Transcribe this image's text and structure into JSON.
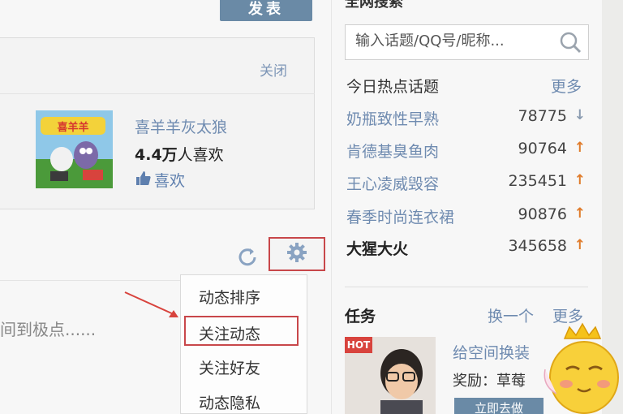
{
  "publish": {
    "label": "发表"
  },
  "recommend": {
    "close": "关闭",
    "game_title": "喜羊羊灰太狼",
    "likes_number": "4.4万",
    "likes_suffix": "人喜欢",
    "like_label": "喜欢"
  },
  "feed": {
    "text": "间到极点......"
  },
  "feed_menu": {
    "items": [
      "动态排序",
      "关注动态",
      "关注好友",
      "动态隐私"
    ],
    "highlighted_index": 1
  },
  "search": {
    "title": "全网搜索",
    "placeholder": "输入话题/QQ号/昵称..."
  },
  "hot_topics": {
    "title": "今日热点话题",
    "more": "更多",
    "items": [
      {
        "name": "奶瓶致性早熟",
        "count": "78775",
        "trend": "down"
      },
      {
        "name": "肯德基臭鱼肉",
        "count": "90764",
        "trend": "up"
      },
      {
        "name": "王心凌威毁容",
        "count": "235451",
        "trend": "up"
      },
      {
        "name": "春季时尚连衣裙",
        "count": "90876",
        "trend": "up"
      },
      {
        "name": "大猩大火",
        "count": "345658",
        "trend": "up"
      }
    ]
  },
  "tasks": {
    "title": "任务",
    "switch": "换一个",
    "more": "更多",
    "badge": "HOT",
    "name": "给空间换装",
    "reward": "奖励：草莓",
    "button": "立即去做"
  },
  "colors": {
    "accent": "#6a8aa6",
    "link": "#6f8bb0",
    "highlight_border": "#c8474a",
    "trend_up": "#e07b2a",
    "trend_down": "#8a9bb0"
  }
}
